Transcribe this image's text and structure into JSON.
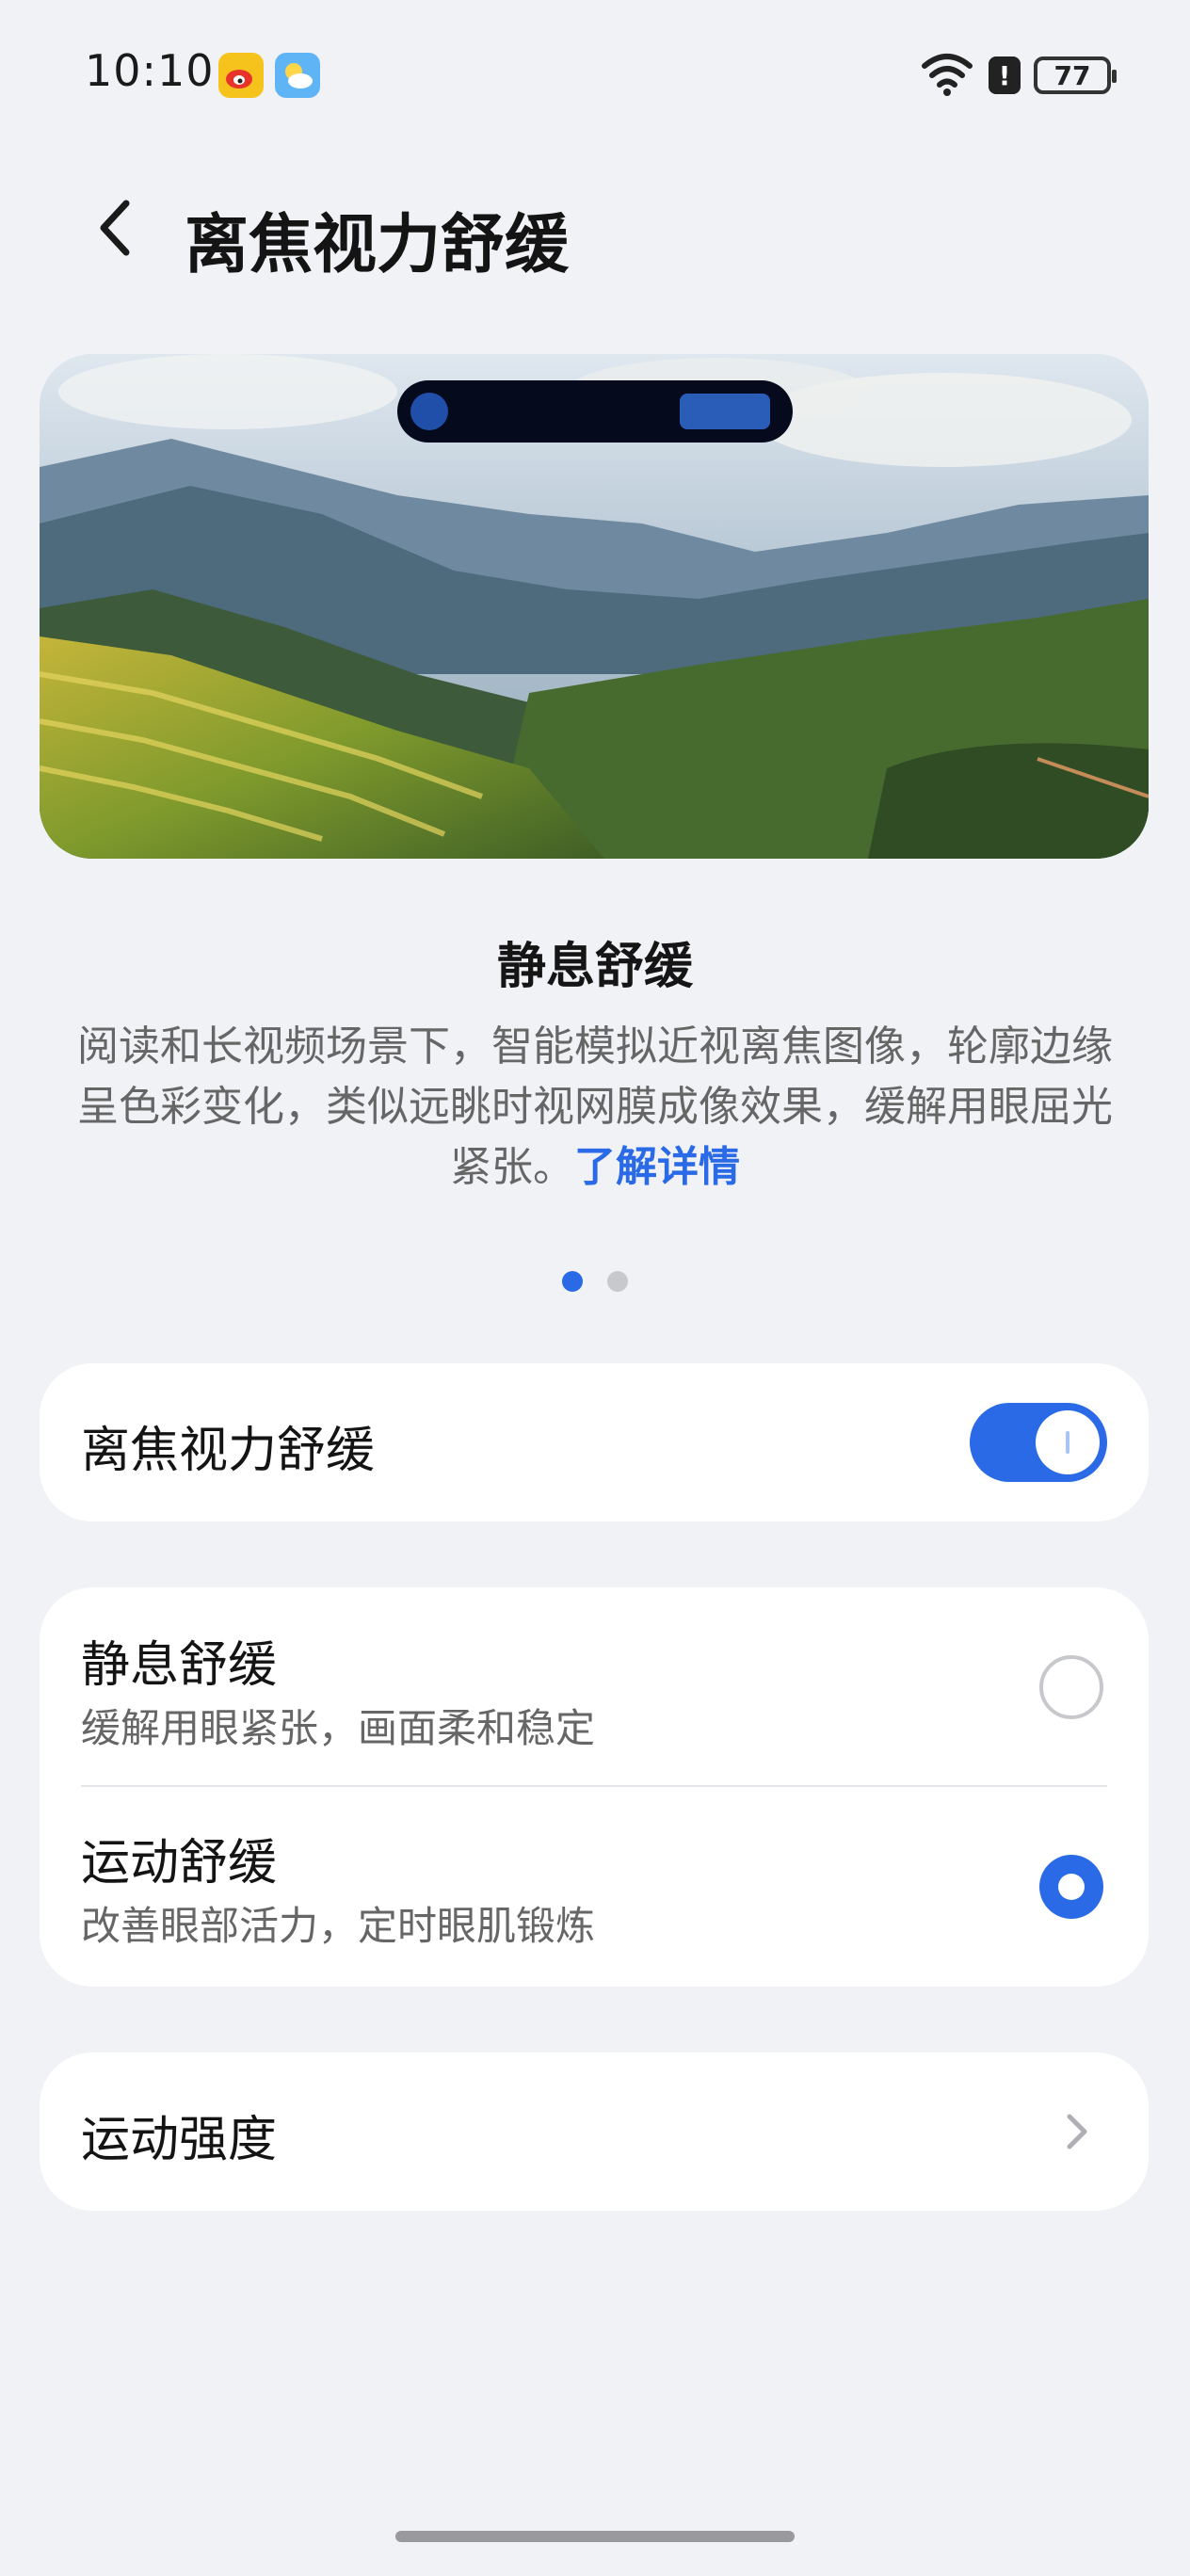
{
  "status_bar": {
    "time": "10:10",
    "battery": "77",
    "icons": [
      "weibo-icon",
      "weather-icon",
      "wifi-icon",
      "alert-icon",
      "battery-icon"
    ]
  },
  "header": {
    "title": "离焦视力舒缓",
    "back_icon": "chevron-left-icon"
  },
  "hero": {
    "image": "mountain-terrace-landscape"
  },
  "description": {
    "title": "静息舒缓",
    "body": "阅读和长视频场景下，智能模拟近视离焦图像，轮廓边缘呈色彩变化，类似远眺时视网膜成像效果，缓解用眼屈光紧张。",
    "link": "了解详情"
  },
  "pager": {
    "count": 2,
    "active_index": 0
  },
  "toggle_card": {
    "label": "离焦视力舒缓",
    "enabled": true
  },
  "options": [
    {
      "title": "静息舒缓",
      "subtitle": "缓解用眼紧张，画面柔和稳定",
      "selected": false
    },
    {
      "title": "运动舒缓",
      "subtitle": "改善眼部活力，定时眼肌锻炼",
      "selected": true
    }
  ],
  "intensity": {
    "label": "运动强度"
  },
  "colors": {
    "accent": "#2a6ae6",
    "background": "#f1f2f6",
    "card": "#ffffff"
  }
}
